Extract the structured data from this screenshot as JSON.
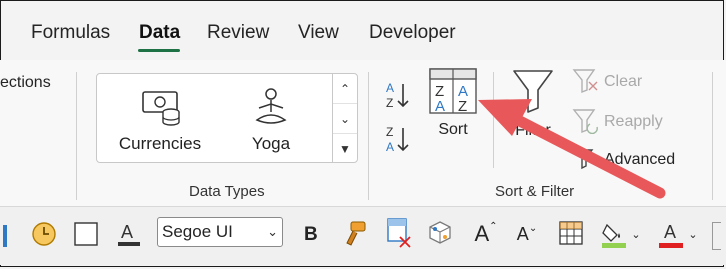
{
  "tabs": [
    "Formulas",
    "Data",
    "Review",
    "View",
    "Developer"
  ],
  "active_tab": "Data",
  "left_partial": "ections",
  "data_types": {
    "items": [
      {
        "label": "Currencies",
        "icon": "currencies-icon"
      },
      {
        "label": "Yoga",
        "icon": "yoga-icon"
      }
    ],
    "group_label": "Data Types"
  },
  "sort_filter": {
    "sort_label": "Sort",
    "sort_az_icon": "sort-a-to-z-icon",
    "sort_za_icon": "sort-z-to-a-icon",
    "filter_label": "Filter",
    "clear_label": "Clear",
    "reapply_label": "Reapply",
    "advanced_label": "Advanced",
    "group_label": "Sort & Filter"
  },
  "quick_access": {
    "font_name": "Segoe UI",
    "bold_label": "B",
    "font_size_increase": "A",
    "font_size_decrease": "A",
    "font_color_label": "A",
    "text_color_label": "A"
  },
  "colors": {
    "accent_green": "#1e7145",
    "annotation_arrow": "#e8585a",
    "sort_blue": "#2f78c4",
    "font_color_red": "#e02020",
    "fill_green": "#92d050"
  }
}
